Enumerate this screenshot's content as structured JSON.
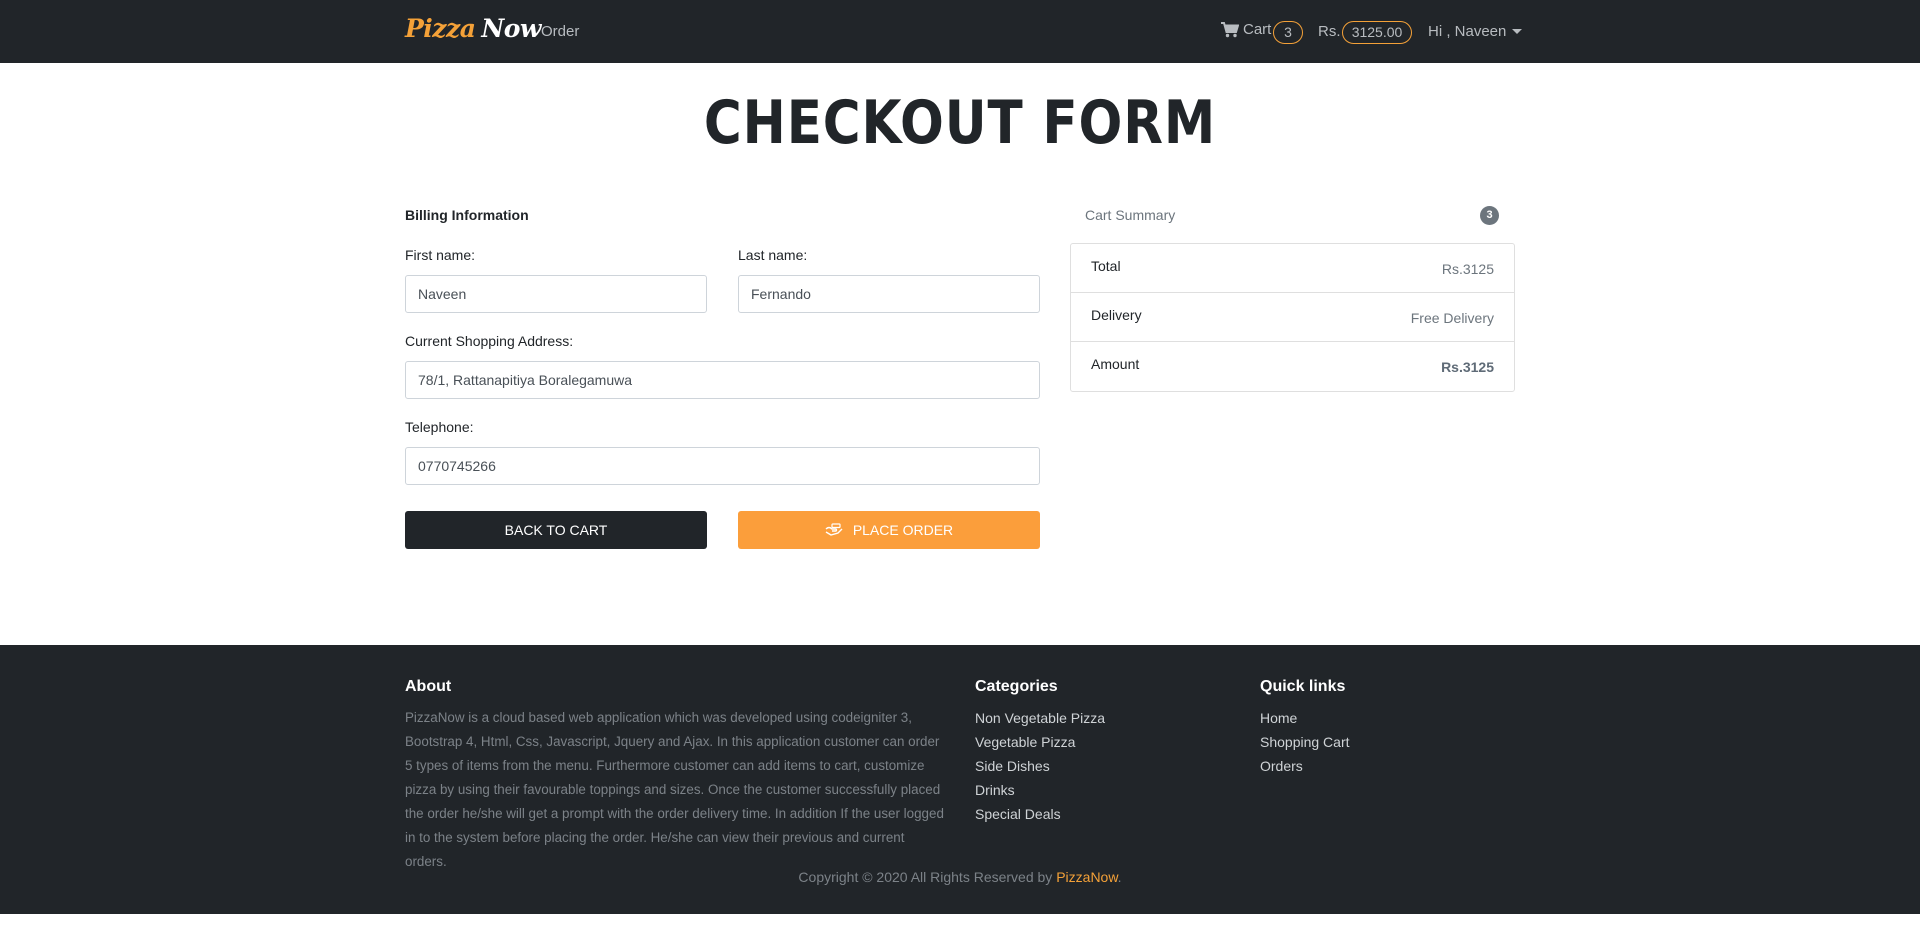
{
  "navbar": {
    "brand_part1": "Pizza",
    "brand_part2": "Now",
    "order_link": "Order",
    "cart_label": "Cart",
    "cart_count": "3",
    "currency_label": "Rs.",
    "cart_total": "3125.00",
    "user_greeting": "Hi , Naveen",
    "accent_color": "#f4a138"
  },
  "page": {
    "title": "CHECKOUT FORM"
  },
  "billing": {
    "section_title": "Billing Information",
    "first_name_label": "First name:",
    "first_name_value": "Naveen",
    "last_name_label": "Last name:",
    "last_name_value": "Fernando",
    "address_label": "Current Shopping Address:",
    "address_value": "78/1, Rattanapitiya Boralegamuwa",
    "telephone_label": "Telephone:",
    "telephone_value": "0770745266",
    "back_button": "BACK TO CART",
    "place_order_button": "PLACE ORDER",
    "place_order_icon": "payment-icon"
  },
  "summary": {
    "title": "Cart Summary",
    "count": "3",
    "rows": [
      {
        "label": "Total",
        "value": "Rs.3125"
      },
      {
        "label": "Delivery",
        "value": "Free Delivery"
      },
      {
        "label": "Amount",
        "value": "Rs.3125"
      }
    ]
  },
  "footer": {
    "about_title": "About",
    "about_text": "PizzaNow is a cloud based web application which was developed using codeigniter 3, Bootstrap 4, Html, Css, Javascript, Jquery and Ajax. In this application customer can order 5 types of items from the menu. Furthermore customer can add items to cart, customize pizza by using their favourable toppings and sizes. Once the customer successfully placed the order he/she will get a prompt with the order delivery time. In addition If the user logged in to the system before placing the order. He/she can view their previous and current orders.",
    "categories_title": "Categories",
    "categories": [
      "Non Vegetable Pizza",
      "Vegetable Pizza",
      "Side Dishes",
      "Drinks",
      "Special Deals"
    ],
    "quicklinks_title": "Quick links",
    "quicklinks": [
      "Home",
      "Shopping Cart",
      "Orders"
    ],
    "copyright_prefix": "Copyright © 2020 All Rights Reserved by",
    "copyright_brand": "PizzaNow",
    "copyright_suffix": "."
  }
}
